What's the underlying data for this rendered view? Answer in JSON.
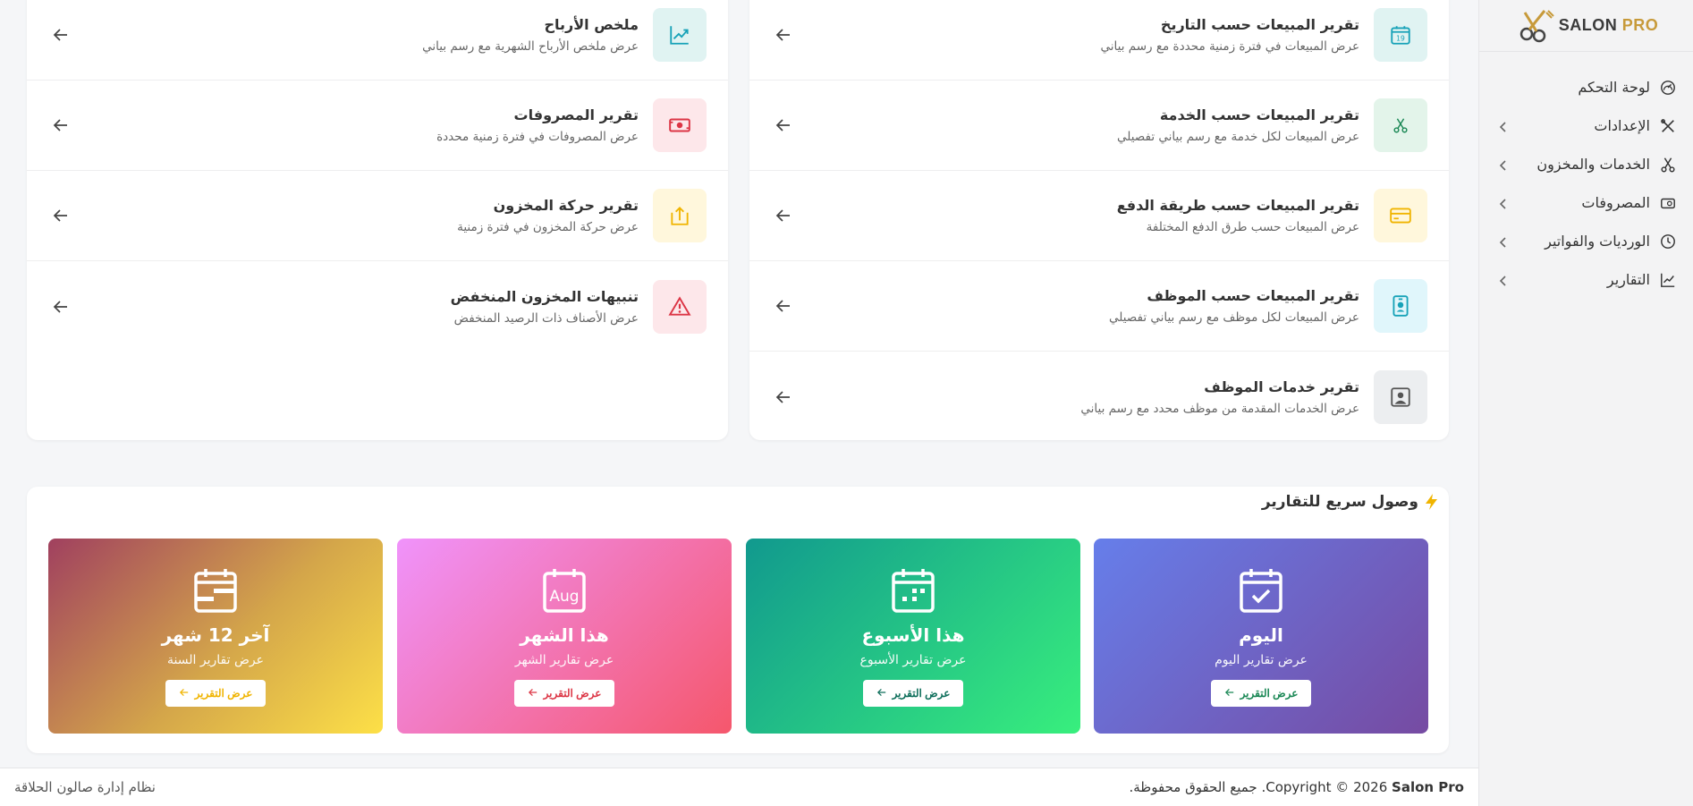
{
  "brand": {
    "name_main": "SALON ",
    "name_accent": "PRO"
  },
  "sidebar": {
    "items": [
      {
        "label": "لوحة التحكم",
        "icon": "dashboard-icon",
        "has_children": false
      },
      {
        "label": "الإعدادات",
        "icon": "settings-icon",
        "has_children": true
      },
      {
        "label": "الخدمات والمخزون",
        "icon": "scissors-icon",
        "has_children": true
      },
      {
        "label": "المصروفات",
        "icon": "money-icon",
        "has_children": true
      },
      {
        "label": "الورديات والفواتير",
        "icon": "clock-icon",
        "has_children": true
      },
      {
        "label": "التقارير",
        "icon": "chart-icon",
        "has_children": true
      }
    ]
  },
  "reports_right": [
    {
      "title": "تقرير المبيعات حسب التاريخ",
      "desc": "عرض المبيعات في فترة زمنية محددة مع رسم بياني",
      "icon": "calendar-icon",
      "bg": "#e0f3f2",
      "color": "#17a2b8"
    },
    {
      "title": "تقرير المبيعات حسب الخدمة",
      "desc": "عرض المبيعات لكل خدمة مع رسم بياني تفصيلي",
      "icon": "scissors-icon",
      "bg": "#e3f4ea",
      "color": "#198754"
    },
    {
      "title": "تقرير المبيعات حسب طريقة الدفع",
      "desc": "عرض المبيعات حسب طرق الدفع المختلفة",
      "icon": "credit-card-icon",
      "bg": "#fff7dc",
      "color": "#f0b400"
    },
    {
      "title": "تقرير المبيعات حسب الموظف",
      "desc": "عرض المبيعات لكل موظف مع رسم بياني تفصيلي",
      "icon": "badge-icon",
      "bg": "#e0f6fb",
      "color": "#17a2b8"
    },
    {
      "title": "تقرير خدمات الموظف",
      "desc": "عرض الخدمات المقدمة من موظف محدد مع رسم بياني",
      "icon": "person-frame-icon",
      "bg": "#eceef0",
      "color": "#555"
    }
  ],
  "reports_left": [
    {
      "title": "ملخص الأرباح",
      "desc": "عرض ملخص الأرباح الشهرية مع رسم بياني",
      "icon": "trend-up-icon",
      "bg": "#e0f3f2",
      "color": "#17a2b8"
    },
    {
      "title": "تقرير المصروفات",
      "desc": "عرض المصروفات في فترة زمنية محددة",
      "icon": "cash-icon",
      "bg": "#fde7ea",
      "color": "#dc3545"
    },
    {
      "title": "تقرير حركة المخزون",
      "desc": "عرض حركة المخزون في فترة زمنية",
      "icon": "box-arrow-icon",
      "bg": "#fff7dc",
      "color": "#f0b400"
    },
    {
      "title": "تنبيهات المخزون المنخفض",
      "desc": "عرض الأصناف ذات الرصيد المنخفض",
      "icon": "warning-icon",
      "bg": "#fde7ea",
      "color": "#dc3545"
    }
  ],
  "quick": {
    "title": "وصول سريع للتقارير",
    "tiles": [
      {
        "title": "اليوم",
        "sub": "عرض تقارير اليوم",
        "btn": "عرض التقرير",
        "icon": "calendar-check-icon",
        "btn_color": "#198754",
        "gradient": "linear-gradient(135deg,#667eea 0%,#764ba2 100%)"
      },
      {
        "title": "هذا الأسبوع",
        "sub": "عرض تقارير الأسبوع",
        "btn": "عرض التقرير",
        "icon": "calendar-week-icon",
        "btn_color": "#0d6e5a",
        "gradient": "linear-gradient(135deg,#11998e 0%,#38ef7d 100%)"
      },
      {
        "title": "هذا الشهر",
        "sub": "عرض تقارير الشهر",
        "btn": "عرض التقرير",
        "icon": "calendar-month-icon",
        "btn_color": "#dc3545",
        "gradient": "linear-gradient(135deg,#f093fb 0%,#f5576c 100%)"
      },
      {
        "title": "آخر 12 شهر",
        "sub": "عرض تقارير السنة",
        "btn": "عرض التقرير",
        "icon": "calendar-range-icon",
        "btn_color": "#f0b400",
        "gradient": "linear-gradient(135deg,#a0405f 0%,#d4a64a 55%,#fde047 100%)"
      }
    ]
  },
  "footer": {
    "copyright_pre": "Copyright © 2026 ",
    "copyright_brand": "Salon Pro",
    "rights": ". جميع الحقوق محفوظة.",
    "system": "نظام إدارة صالون الحلاقة"
  }
}
